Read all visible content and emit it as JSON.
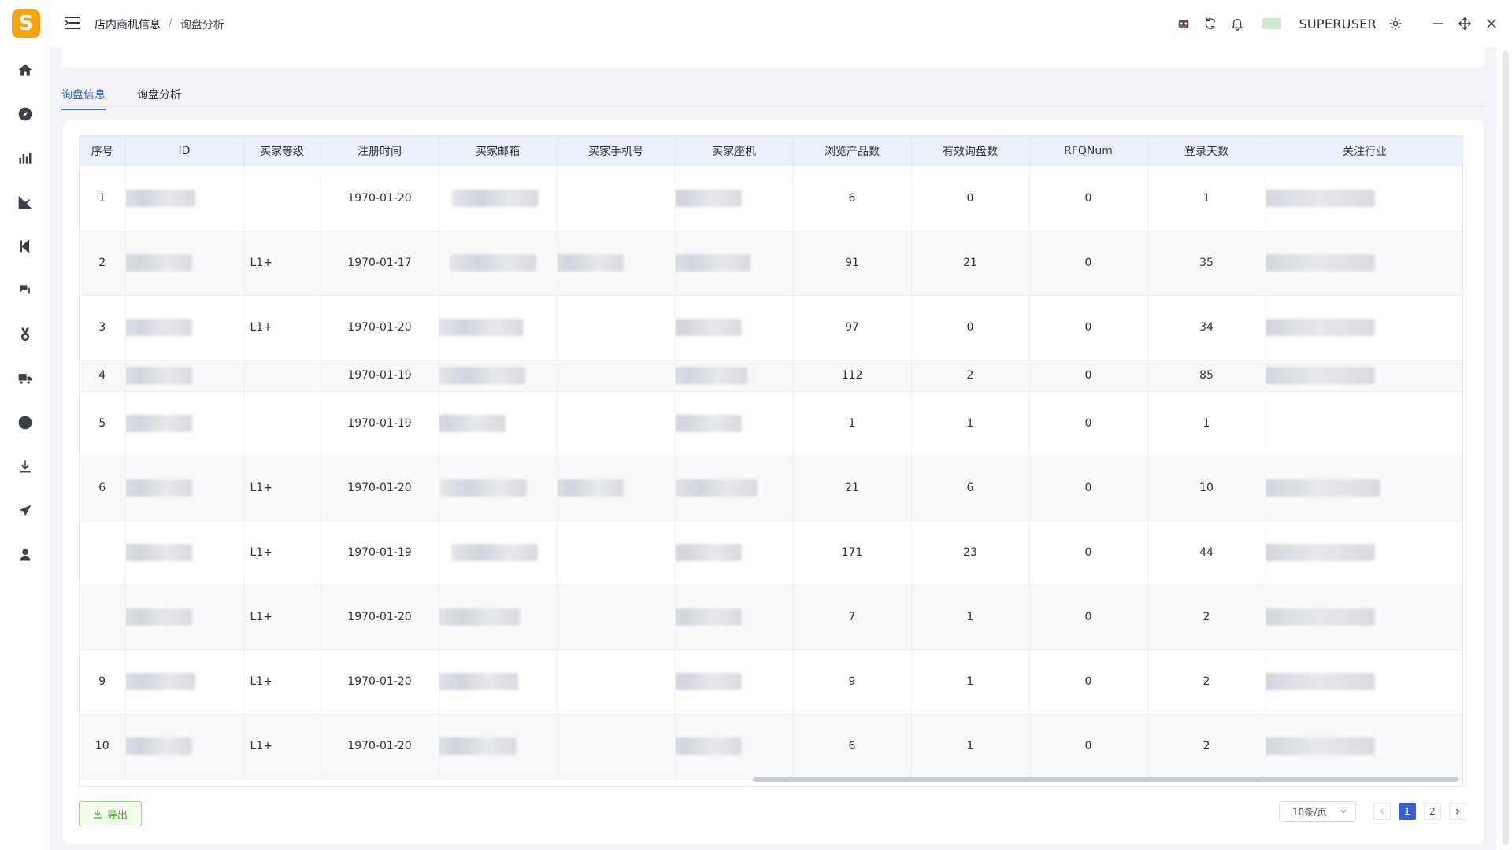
{
  "logo": {
    "letter": "S"
  },
  "breadcrumb": {
    "parent": "店内商机信息",
    "separator": "/",
    "current": "询盘分析"
  },
  "header": {
    "username": "SUPERUSER"
  },
  "tabs": [
    {
      "label": "询盘信息",
      "active": true
    },
    {
      "label": "询盘分析",
      "active": false
    }
  ],
  "table": {
    "columns": [
      "序号",
      "ID",
      "买家等级",
      "注册时间",
      "买家邮箱",
      "买家手机号",
      "买家座机",
      "浏览产品数",
      "有效询盘数",
      "RFQNum",
      "登录天数",
      "关注行业"
    ],
    "rows": [
      {
        "no": "1",
        "id": "5",
        "level": "",
        "reg": "1970-01-20",
        "email": "colou…09…",
        "mobile": "",
        "phone": "",
        "views": "6",
        "valid": "0",
        "rfq": "0",
        "days": "1",
        "industry": ""
      },
      {
        "no": "2",
        "id": "",
        "level": "L1+",
        "reg": "1970-01-17",
        "email": "n…sanao…",
        "mobile": "",
        "phone": "…1",
        "views": "91",
        "valid": "21",
        "rfq": "0",
        "days": "35",
        "industry": ""
      },
      {
        "no": "3",
        "id": "",
        "level": "L1+",
        "reg": "1970-01-20",
        "email": "y…n…",
        "mobile": "",
        "phone": "",
        "views": "97",
        "valid": "0",
        "rfq": "0",
        "days": "34",
        "industry": ""
      },
      {
        "no": "4",
        "id": "",
        "level": "",
        "reg": "1970-01-19",
        "email": "…t…co",
        "mobile": "",
        "phone": "…",
        "views": "112",
        "valid": "2",
        "rfq": "0",
        "days": "85",
        "industry": ""
      },
      {
        "no": "5",
        "id": "",
        "level": "",
        "reg": "1970-01-19",
        "email": "",
        "mobile": "",
        "phone": "",
        "views": "1",
        "valid": "1",
        "rfq": "0",
        "days": "1",
        "industry": ""
      },
      {
        "no": "6",
        "id": "",
        "level": "L1+",
        "reg": "1970-01-20",
        "email": "an…34(",
        "mobile": "",
        "phone": "135…",
        "views": "21",
        "valid": "6",
        "rfq": "0",
        "days": "10",
        "industry": "L"
      },
      {
        "no": "",
        "id": "",
        "level": "L1+",
        "reg": "1970-01-19",
        "email": "r…tos…m…",
        "mobile": "",
        "phone": "",
        "views": "171",
        "valid": "23",
        "rfq": "0",
        "days": "44",
        "industry": ""
      },
      {
        "no": "",
        "id": "",
        "level": "L1+",
        "reg": "1970-01-20",
        "email": "j…tlo",
        "mobile": "",
        "phone": "",
        "views": "7",
        "valid": "1",
        "rfq": "0",
        "days": "2",
        "industry": ""
      },
      {
        "no": "9",
        "id": "2",
        "level": "L1+",
        "reg": "1970-01-20",
        "email": "op…",
        "mobile": "",
        "phone": "",
        "views": "9",
        "valid": "1",
        "rfq": "0",
        "days": "2",
        "industry": ""
      },
      {
        "no": "10",
        "id": "",
        "level": "L1+",
        "reg": "1970-01-20",
        "email": "d….",
        "mobile": "",
        "phone": "",
        "views": "6",
        "valid": "1",
        "rfq": "0",
        "days": "2",
        "industry": ""
      }
    ]
  },
  "footer": {
    "export_label": "导出",
    "page_size": "10条/页",
    "pages": [
      "1",
      "2"
    ],
    "current_page": "1"
  },
  "colors": {
    "accent": "#3b6ad8",
    "logo": "#f5a40f",
    "export": "#52a83b",
    "header_bg": "#e9f0fb"
  }
}
